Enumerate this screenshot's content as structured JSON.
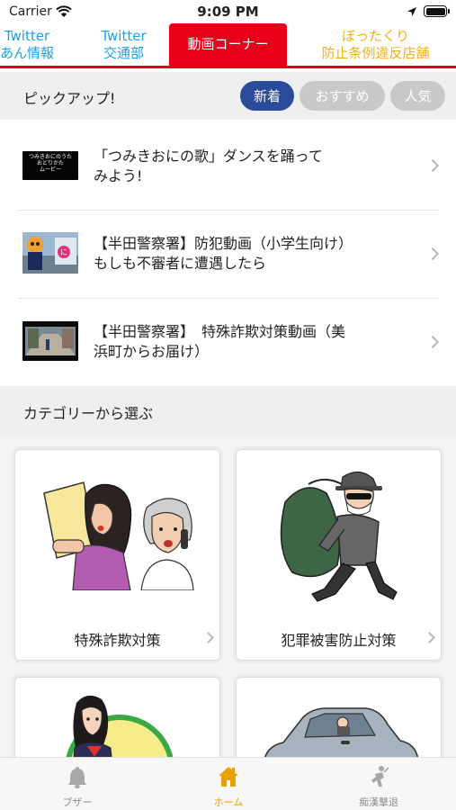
{
  "status_bar": {
    "carrier": "Carrier",
    "time": "9:09 PM"
  },
  "top_tabs": [
    {
      "line1": "Twitter",
      "line2": "あん情報",
      "active": false
    },
    {
      "line1": "Twitter",
      "line2": "交通部",
      "active": false
    },
    {
      "line1": "動画コーナー",
      "line2": "",
      "active": true
    },
    {
      "line1": "ぼったくり",
      "line2": "防止条例違反店舗",
      "active": false
    }
  ],
  "pickup": {
    "title": "ピックアップ!",
    "filters": [
      {
        "label": "新着",
        "selected": true
      },
      {
        "label": "おすすめ",
        "selected": false
      },
      {
        "label": "人気",
        "selected": false
      }
    ]
  },
  "videos": [
    {
      "line1": "「つみきおにの歌」ダンスを踊って",
      "line2": "みよう!",
      "thumb_text": [
        "つみきおにのうた",
        "おどりかた",
        "ムービー"
      ]
    },
    {
      "line1": "【半田警察署】防犯動画（小学生向け）",
      "line2": "もしも不審者に遭遇したら"
    },
    {
      "line1": "【半田警察署】　特殊詐欺対策動画（美",
      "line2": "浜町からお届け）"
    }
  ],
  "categories": {
    "title": "カテゴリーから選ぶ",
    "items": [
      {
        "label": "特殊詐欺対策"
      },
      {
        "label": "犯罪被害防止対策"
      },
      {
        "label": ""
      },
      {
        "label": ""
      }
    ]
  },
  "bottom_tabs": [
    {
      "label": "ブザー",
      "active": false
    },
    {
      "label": "ホーム",
      "active": true
    },
    {
      "label": "痴漢撃退",
      "active": false
    }
  ],
  "colors": {
    "accent_red": "#e8001a",
    "tab_blue": "#1aa3e0",
    "tab_orange": "#f5b018",
    "pill_navy": "#2a4a9a",
    "home_active": "#e8a200"
  }
}
